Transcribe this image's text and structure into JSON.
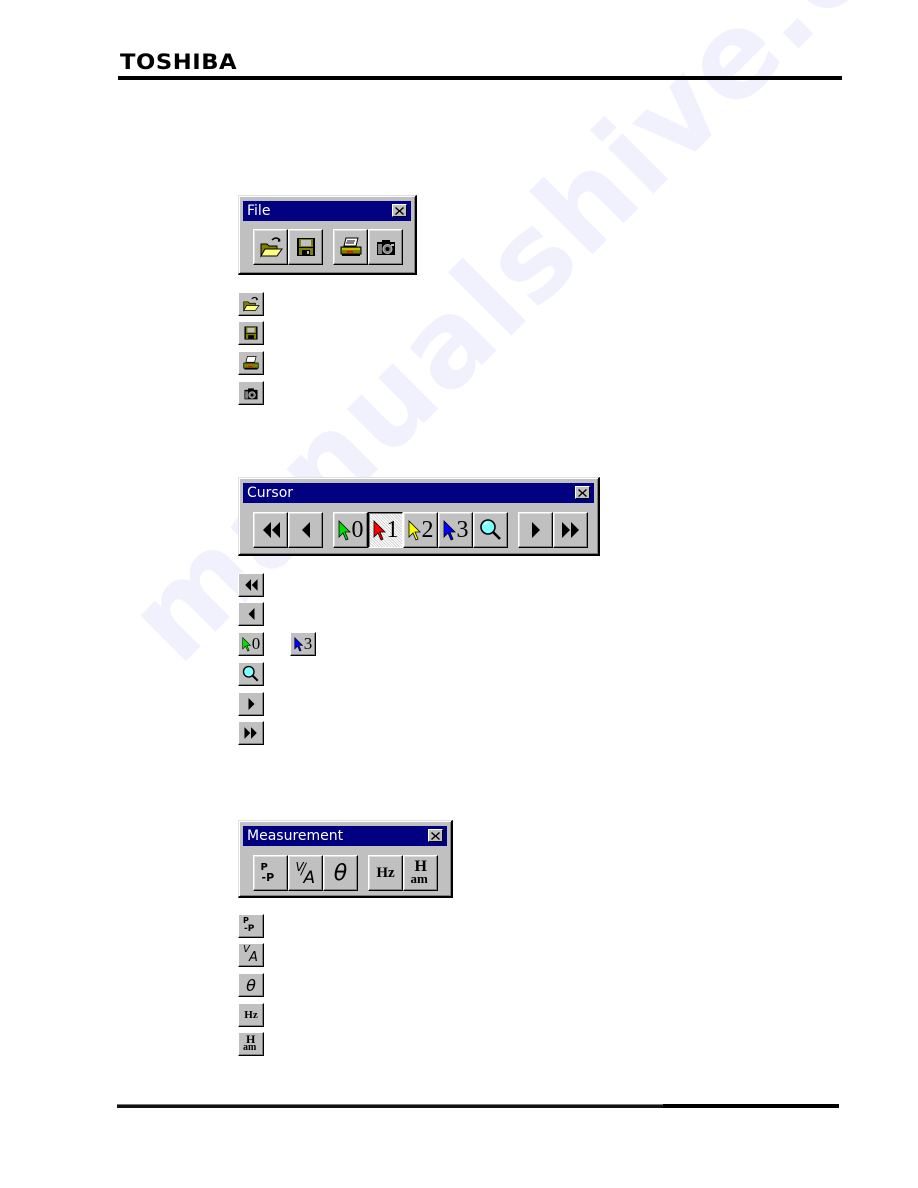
{
  "header": {
    "brand": "TOSHIBA"
  },
  "watermark": "manualshive.com",
  "file_toolbar": {
    "title": "File",
    "close_icon": "close-x-icon",
    "buttons": [
      {
        "id": "open",
        "icon": "open-folder-icon"
      },
      {
        "id": "save",
        "icon": "floppy-disk-icon"
      },
      {
        "id": "print",
        "icon": "printer-icon"
      },
      {
        "id": "screenshot",
        "icon": "camera-icon"
      }
    ]
  },
  "file_icons_list": [
    "open-folder-icon",
    "floppy-disk-icon",
    "printer-icon",
    "camera-icon"
  ],
  "cursor_toolbar": {
    "title": "Cursor",
    "close_icon": "close-x-icon",
    "buttons": [
      {
        "id": "fast-back",
        "icon": "double-left-triangle-icon"
      },
      {
        "id": "step-back",
        "icon": "left-triangle-icon"
      },
      {
        "id": "cursor-0",
        "icon": "cursor-arrow-icon",
        "label": "0",
        "color": "#00e000"
      },
      {
        "id": "cursor-1",
        "icon": "cursor-arrow-icon",
        "label": "1",
        "color": "#ff0000",
        "pressed": true
      },
      {
        "id": "cursor-2",
        "icon": "cursor-arrow-icon",
        "label": "2",
        "color": "#ffff00"
      },
      {
        "id": "cursor-3",
        "icon": "cursor-arrow-icon",
        "label": "3",
        "color": "#0000ff"
      },
      {
        "id": "zoom",
        "icon": "magnifier-icon"
      },
      {
        "id": "step-forward",
        "icon": "right-triangle-icon"
      },
      {
        "id": "fast-forward",
        "icon": "double-right-triangle-icon"
      }
    ]
  },
  "cursor_icons_list": {
    "fast_back": "double-left-triangle-icon",
    "step_back": "left-triangle-icon",
    "cursor_first": {
      "label": "0",
      "color": "#00e000"
    },
    "cursor_last": {
      "label": "3",
      "color": "#0000ff"
    },
    "zoom": "magnifier-icon",
    "step_forward": "right-triangle-icon",
    "fast_forward": "double-right-triangle-icon"
  },
  "measurement_toolbar": {
    "title": "Measurement",
    "close_icon": "close-x-icon",
    "buttons": [
      {
        "id": "peak-to-peak",
        "label_top": "P",
        "label_bottom": "-P"
      },
      {
        "id": "volt-ampere",
        "label_top": "V",
        "label_bottom": "A"
      },
      {
        "id": "phase",
        "label": "θ"
      },
      {
        "id": "frequency",
        "label": "Hz"
      },
      {
        "id": "harmonics",
        "label_top": "H",
        "label_bottom": "am"
      }
    ]
  }
}
